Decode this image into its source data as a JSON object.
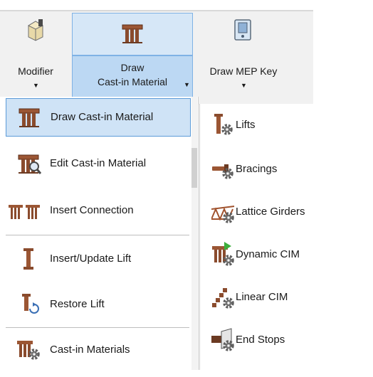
{
  "ribbon": {
    "modifier": {
      "label": "Modifier",
      "icon": "modifier-cube-icon"
    },
    "draw": {
      "label_line1": "Draw",
      "label_line2": "Cast-in Material",
      "icon": "cast-in-material-icon"
    },
    "draw_mep_key": {
      "label": "Draw MEP Key",
      "icon": "mep-key-icon"
    }
  },
  "menu": {
    "items": [
      {
        "label": "Draw  Cast-in Material",
        "icon": "cast-in-material-icon",
        "active": true
      },
      {
        "label": "Edit  Cast-in Material",
        "icon": "edit-cast-in-material-icon"
      },
      {
        "label": "Insert Connection",
        "icon": "connection-icon"
      },
      {
        "label": "Insert/Update  Lift",
        "icon": "lift-icon"
      },
      {
        "label": "Restore  Lift",
        "icon": "restore-lift-icon"
      },
      {
        "label": "Cast-in Materials",
        "icon": "cast-in-materials-settings-icon"
      }
    ]
  },
  "submenu": {
    "items": [
      {
        "label": "Lifts",
        "icon": "lifts-gear-icon"
      },
      {
        "label": "Bracings",
        "icon": "bracings-gear-icon"
      },
      {
        "label": "Lattice Girders",
        "icon": "lattice-girders-gear-icon"
      },
      {
        "label": "Dynamic CIM",
        "icon": "dynamic-cim-gear-icon"
      },
      {
        "label": "Linear CIM",
        "icon": "linear-cim-gear-icon"
      },
      {
        "label": "End Stops",
        "icon": "end-stops-gear-icon"
      }
    ]
  },
  "colors": {
    "ribbon_bg": "#f1f1f1",
    "hover_bg": "#cfe3f6",
    "hover_border": "#5c9bd8",
    "icon_brown": "#8a4b2d",
    "gear_gray": "#6e6e6e"
  }
}
